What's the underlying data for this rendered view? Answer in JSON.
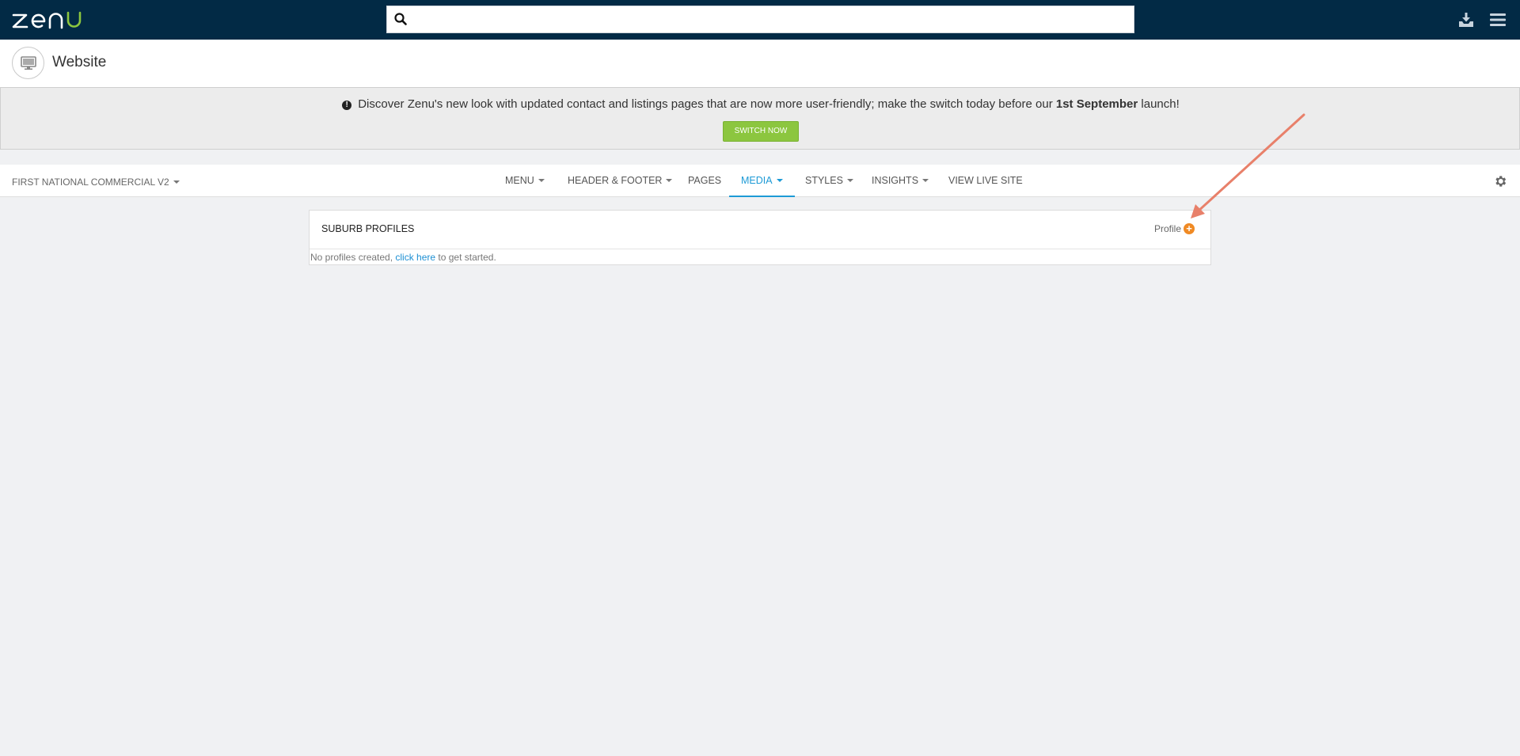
{
  "topbar": {
    "logo_text": "zenu",
    "search_placeholder": "",
    "icons": [
      "download-icon",
      "hamburger-menu-icon"
    ],
    "background": "#022a45",
    "brand_green": "#8cc63f"
  },
  "page": {
    "icon": "monitor-icon",
    "title": "Website"
  },
  "notice": {
    "text_before": "Discover Zenu's new look with updated contact and listings pages that are now more user-friendly; make the switch today before our ",
    "bold": "1st September",
    "text_after": " launch!",
    "button": "SWITCH NOW"
  },
  "nav": {
    "site_selector": "FIRST NATIONAL COMMERCIAL V2",
    "items": [
      {
        "label": "MENU",
        "dropdown": true
      },
      {
        "label": "HEADER & FOOTER",
        "dropdown": true
      },
      {
        "label": "PAGES",
        "dropdown": false
      },
      {
        "label": "MEDIA",
        "dropdown": true,
        "active": true
      },
      {
        "label": "STYLES",
        "dropdown": true
      },
      {
        "label": "INSIGHTS",
        "dropdown": true
      },
      {
        "label": "VIEW LIVE SITE",
        "dropdown": false
      }
    ],
    "active_color": "#1d9ad6"
  },
  "panel": {
    "title": "SUBURB PROFILES",
    "add_label": "Profile",
    "empty_before": "No profiles created, ",
    "empty_link": "click here",
    "empty_after": " to get started."
  },
  "annotation": {
    "arrow_color": "#e8806a"
  }
}
